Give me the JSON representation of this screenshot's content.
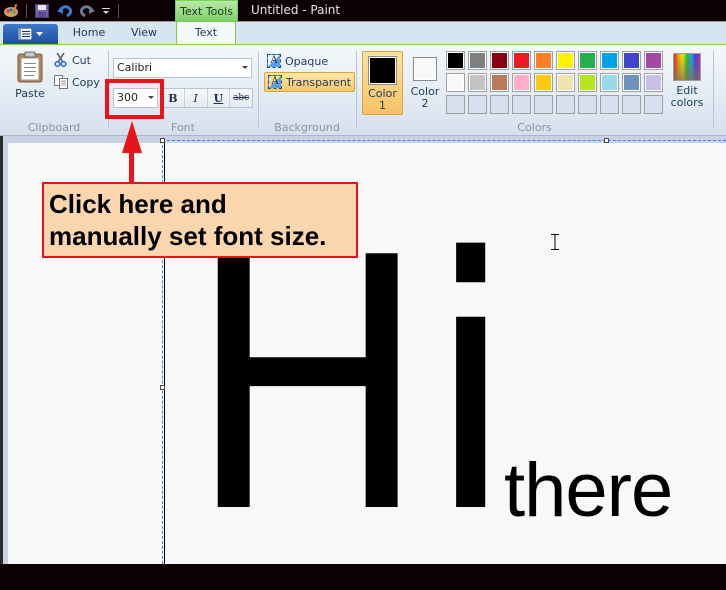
{
  "window": {
    "title": "Untitled - Paint",
    "contextual_tab_group": "Text Tools"
  },
  "quick_access": {
    "icons": [
      "paint-app-icon",
      "save-icon",
      "undo-icon",
      "redo-icon",
      "customize-dropdown-icon"
    ]
  },
  "tabs": [
    {
      "label": "Home",
      "active": false
    },
    {
      "label": "View",
      "active": false
    },
    {
      "label": "Text",
      "active": true
    }
  ],
  "ribbon": {
    "clipboard": {
      "label": "Clipboard",
      "paste": "Paste",
      "cut": "Cut",
      "copy": "Copy"
    },
    "font": {
      "label": "Font",
      "family": "Calibri",
      "size": "300",
      "bold": "B",
      "italic": "I",
      "underline": "U",
      "strikethrough": "abc"
    },
    "background": {
      "label": "Background",
      "opaque": "Opaque",
      "transparent": "Transparent",
      "selected": "Transparent"
    },
    "colors": {
      "label": "Colors",
      "color1_label": "Color",
      "color1_num": "1",
      "color1_value": "#000000",
      "color2_label": "Color",
      "color2_num": "2",
      "color2_value": "#f8f8f8",
      "edit_colors_line1": "Edit",
      "edit_colors_line2": "colors",
      "palette_row1": [
        "#000000",
        "#7f7f7f",
        "#880015",
        "#ed1c24",
        "#ff7f27",
        "#fff200",
        "#22b14c",
        "#00a2e8",
        "#3f48cc",
        "#a349a4"
      ],
      "palette_row2": [
        "#f8f8f8",
        "#c3c3c3",
        "#b97a57",
        "#ffaec9",
        "#ffc90e",
        "#efe4b0",
        "#b5e61d",
        "#99d9ea",
        "#7092be",
        "#c8bfe7"
      ],
      "palette_row3_empty": 10
    }
  },
  "canvas": {
    "big_text": "Hi",
    "small_text": "there"
  },
  "annotation": {
    "line1": "Click here and",
    "line2": "manually set font size.",
    "border_color": "#e8141a",
    "fill_color": "#f9d6ac"
  }
}
